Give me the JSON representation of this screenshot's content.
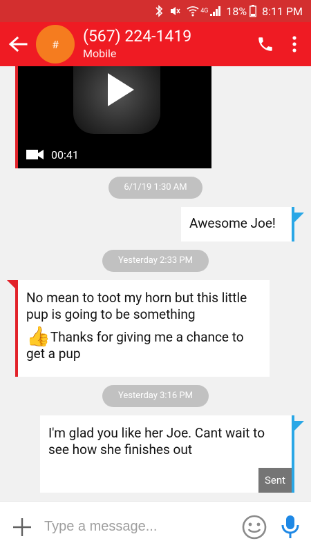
{
  "status_bar": {
    "network": "4G",
    "battery": "18%",
    "time": "8:11 PM",
    "icons": [
      "bluetooth-icon",
      "mute-icon",
      "wifi-icon",
      "signal-icon",
      "battery-icon"
    ]
  },
  "header": {
    "avatar_text": "#",
    "contact": "(567) 224-1419",
    "subtitle": "Mobile",
    "accent": "#ef1b23",
    "avatar_color": "#f57c1f"
  },
  "conversation": {
    "video": {
      "duration": "00:41"
    },
    "timestamps": [
      "6/1/19 1:30 AM",
      "Yesterday 2:33 PM",
      "Yesterday 3:16 PM"
    ],
    "messages": [
      {
        "direction": "out",
        "text": "Awesome Joe!"
      },
      {
        "direction": "in",
        "line1": "No mean to toot my horn but this little pup is going to be something",
        "line2": "Thanks for giving me a chance to get a pup",
        "emoji": "👍"
      },
      {
        "direction": "out",
        "text": "I'm glad you like her Joe. Cant wait to see how she finishes out",
        "status": "Sent"
      }
    ]
  },
  "composer": {
    "placeholder": "Type a message..."
  }
}
